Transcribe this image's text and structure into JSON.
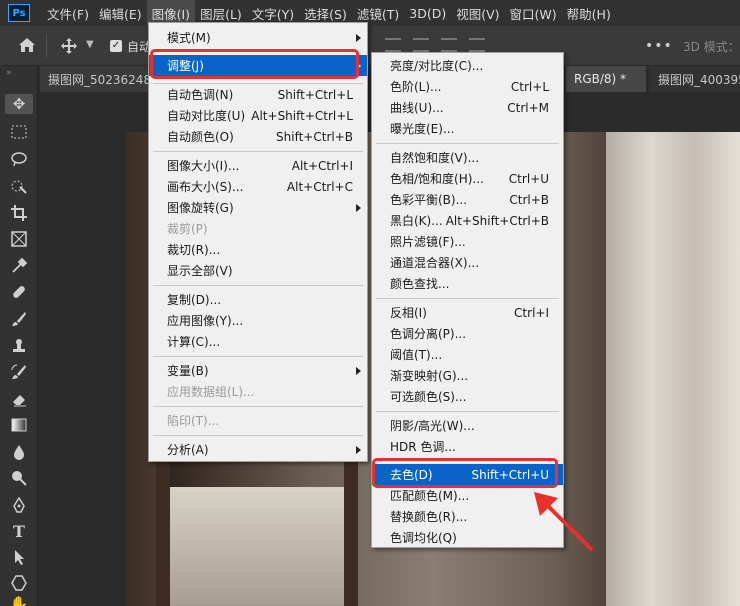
{
  "app": {
    "logo": "Ps"
  },
  "menubar": {
    "items": [
      "文件(F)",
      "编辑(E)",
      "图像(I)",
      "图层(L)",
      "文字(Y)",
      "选择(S)",
      "滤镜(T)",
      "3D(D)",
      "视图(V)",
      "窗口(W)",
      "帮助(H)"
    ],
    "active_index": 2
  },
  "optionsbar": {
    "auto_select_label": "自动",
    "mode_3d_label": "3D 模式："
  },
  "tabs": [
    {
      "label": "摄图网_50236248"
    },
    {
      "label": "RGB/8) *"
    },
    {
      "label": "摄图网_400395"
    }
  ],
  "image_menu": [
    {
      "label": "模式(M)",
      "shortcut": "",
      "submenu": true
    },
    {
      "label": "调整(J)",
      "shortcut": "",
      "submenu": true,
      "highlighted": true
    },
    {
      "label": "自动色调(N)",
      "shortcut": "Shift+Ctrl+L"
    },
    {
      "label": "自动对比度(U)",
      "shortcut": "Alt+Shift+Ctrl+L"
    },
    {
      "label": "自动颜色(O)",
      "shortcut": "Shift+Ctrl+B"
    },
    {
      "label": "图像大小(I)...",
      "shortcut": "Alt+Ctrl+I"
    },
    {
      "label": "画布大小(S)...",
      "shortcut": "Alt+Ctrl+C"
    },
    {
      "label": "图像旋转(G)",
      "shortcut": "",
      "submenu": true
    },
    {
      "label": "裁剪(P)",
      "shortcut": "",
      "disabled": true
    },
    {
      "label": "裁切(R)...",
      "shortcut": ""
    },
    {
      "label": "显示全部(V)",
      "shortcut": ""
    },
    {
      "label": "复制(D)...",
      "shortcut": ""
    },
    {
      "label": "应用图像(Y)...",
      "shortcut": ""
    },
    {
      "label": "计算(C)...",
      "shortcut": ""
    },
    {
      "label": "变量(B)",
      "shortcut": "",
      "submenu": true
    },
    {
      "label": "应用数据组(L)...",
      "shortcut": "",
      "disabled": true
    },
    {
      "label": "陷印(T)...",
      "shortcut": "",
      "disabled": true
    },
    {
      "label": "分析(A)",
      "shortcut": "",
      "submenu": true
    }
  ],
  "adjust_menu": [
    {
      "label": "亮度/对比度(C)...",
      "shortcut": ""
    },
    {
      "label": "色阶(L)...",
      "shortcut": "Ctrl+L"
    },
    {
      "label": "曲线(U)...",
      "shortcut": "Ctrl+M"
    },
    {
      "label": "曝光度(E)...",
      "shortcut": ""
    },
    {
      "label": "自然饱和度(V)...",
      "shortcut": ""
    },
    {
      "label": "色相/饱和度(H)...",
      "shortcut": "Ctrl+U"
    },
    {
      "label": "色彩平衡(B)...",
      "shortcut": "Ctrl+B"
    },
    {
      "label": "黑白(K)...",
      "shortcut": "Alt+Shift+Ctrl+B"
    },
    {
      "label": "照片滤镜(F)...",
      "shortcut": ""
    },
    {
      "label": "通道混合器(X)...",
      "shortcut": ""
    },
    {
      "label": "颜色查找...",
      "shortcut": ""
    },
    {
      "label": "反相(I)",
      "shortcut": "Ctrl+I"
    },
    {
      "label": "色调分离(P)...",
      "shortcut": ""
    },
    {
      "label": "阈值(T)...",
      "shortcut": ""
    },
    {
      "label": "渐变映射(G)...",
      "shortcut": ""
    },
    {
      "label": "可选颜色(S)...",
      "shortcut": ""
    },
    {
      "label": "阴影/高光(W)...",
      "shortcut": ""
    },
    {
      "label": "HDR 色调...",
      "shortcut": ""
    },
    {
      "label": "去色(D)",
      "shortcut": "Shift+Ctrl+U",
      "highlighted": true
    },
    {
      "label": "匹配颜色(M)...",
      "shortcut": ""
    },
    {
      "label": "替换颜色(R)...",
      "shortcut": ""
    },
    {
      "label": "色调均化(Q)",
      "shortcut": ""
    }
  ],
  "colors": {
    "highlight": "#0a64c8",
    "annotation_red": "#e8302c"
  },
  "icons": [
    "home-icon",
    "move-tool-icon",
    "marquee-tool-icon",
    "lasso-tool-icon",
    "quick-select-tool-icon",
    "crop-tool-icon",
    "frame-tool-icon",
    "eyedropper-tool-icon",
    "healing-brush-icon",
    "brush-tool-icon",
    "clone-stamp-icon",
    "history-brush-icon",
    "eraser-tool-icon",
    "gradient-tool-icon",
    "blur-tool-icon",
    "dodge-tool-icon",
    "pen-tool-icon",
    "type-tool-icon",
    "path-select-icon",
    "shape-tool-icon",
    "hand-tool-icon"
  ]
}
